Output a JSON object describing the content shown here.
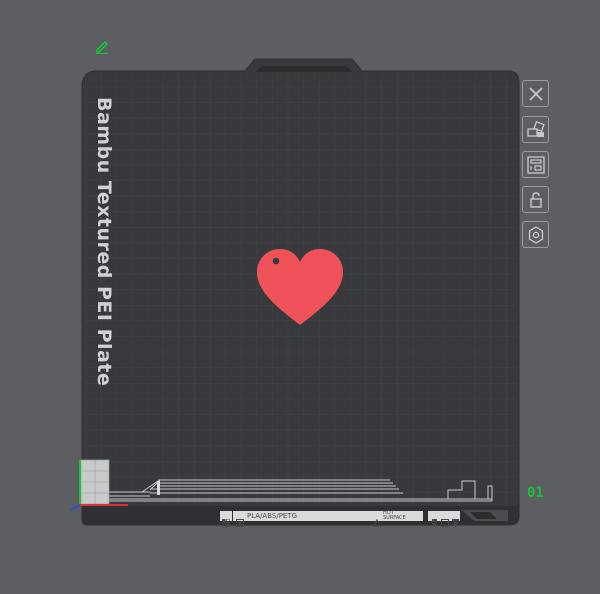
{
  "plate": {
    "name": "Bambu Textured PEI Plate",
    "number": "01",
    "filaments": "PLA/ABS/PETG",
    "hot_surface": "HOT\nSURFACE"
  },
  "colors": {
    "background": "#5c5e62",
    "plate": "#38393c",
    "grid": "#4b4d51",
    "accent_model": "#f0525a",
    "plate_number": "#1fbf3a"
  },
  "object": {
    "name": "heart",
    "selected": false
  },
  "toolbar": {
    "items": [
      {
        "name": "close-icon"
      },
      {
        "name": "arrange-icon"
      },
      {
        "name": "plate-layout-icon"
      },
      {
        "name": "unlock-icon"
      },
      {
        "name": "settings-icon"
      }
    ]
  },
  "icons": {
    "edit": "pencil-icon"
  }
}
